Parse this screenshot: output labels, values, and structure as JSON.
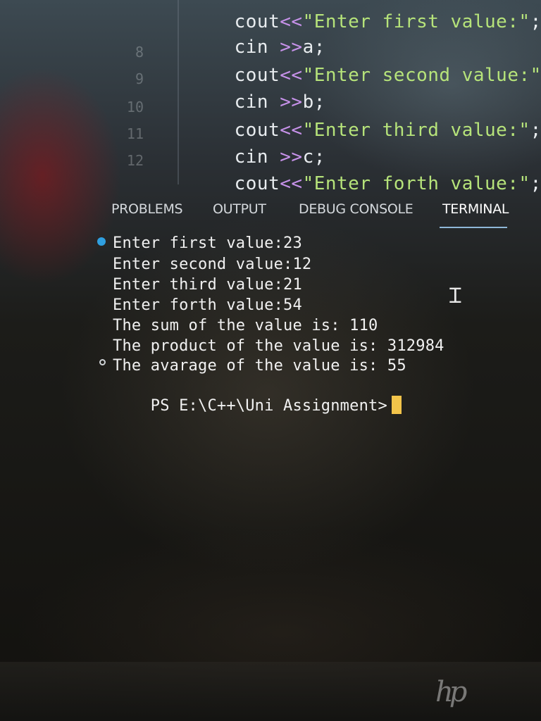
{
  "editor": {
    "line_numbers": [
      "8",
      "9",
      "10",
      "11",
      "12"
    ],
    "lines": [
      {
        "kw": "cout",
        "op": "<<",
        "str": "\"Enter first value:\"",
        "end": ";"
      },
      {
        "kw": "cin ",
        "op": ">>",
        "str": "a",
        "end": ";"
      },
      {
        "kw": "cout",
        "op": "<<",
        "str": "\"Enter second value:\"",
        "end": ";"
      },
      {
        "kw": "cin ",
        "op": ">>",
        "str": "b",
        "end": ";"
      },
      {
        "kw": "cout",
        "op": "<<",
        "str": "\"Enter third value:\"",
        "end": ";"
      },
      {
        "kw": "cin ",
        "op": ">>",
        "str": "c",
        "end": ";"
      },
      {
        "kw": "cout",
        "op": "<<",
        "str": "\"Enter forth value:\"",
        "end": ";"
      }
    ]
  },
  "panel": {
    "tabs": [
      {
        "label": "PROBLEMS"
      },
      {
        "label": "OUTPUT"
      },
      {
        "label": "DEBUG CONSOLE"
      },
      {
        "label": "TERMINAL"
      }
    ],
    "active_tab": "TERMINAL"
  },
  "terminal": {
    "lines": [
      "Enter first value:23",
      "Enter second value:12",
      "Enter third value:21",
      "Enter forth value:54",
      "The sum of the value is: 110",
      "The product of the value is: 312984",
      "The avarage of the value is: 55"
    ],
    "prompt": "PS E:\\C++\\Uni Assignment>"
  },
  "icons": {
    "text_cursor": "i-beam-cursor-icon",
    "brand": "hp-logo-icon"
  },
  "colors": {
    "string": "#b6e37a",
    "operator": "#c792ea",
    "active_tab_underline": "#8fb7d8",
    "cursor": "#f2c44a",
    "status_dot": "#2f9fe0"
  }
}
